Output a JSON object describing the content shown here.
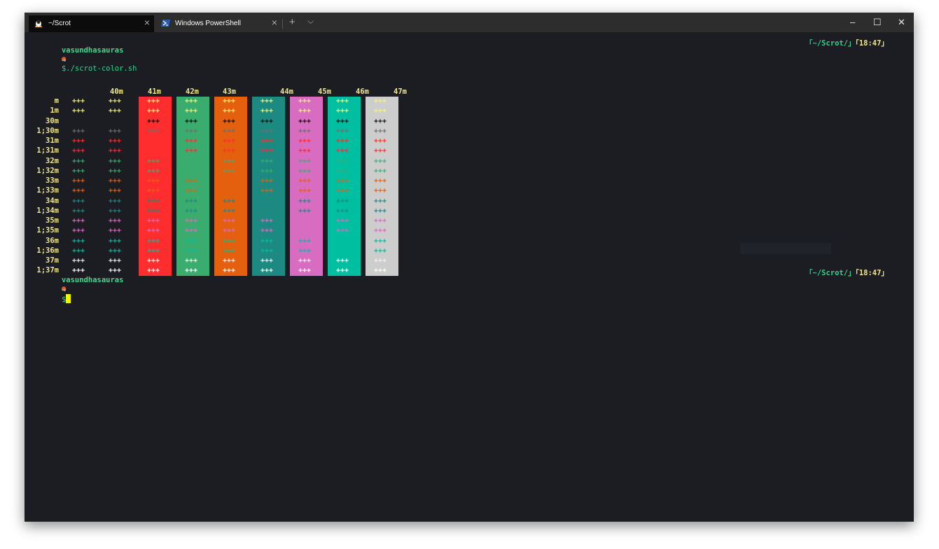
{
  "tabs": [
    {
      "label": "~/Scrot",
      "icon": "linux-icon",
      "active": true
    },
    {
      "label": "Windows PowerShell",
      "icon": "powershell-icon",
      "active": false
    }
  ],
  "tabbar": {
    "new_tab": "+",
    "dropdown": "⌵"
  },
  "window_controls": {
    "minimize": "‒",
    "maximize": "☐",
    "close": "✕"
  },
  "terminal": {
    "prompt1": {
      "user": "vasundhasauras",
      "dot": "●",
      "arrow": "→",
      "command": "$./scrot-color.sh",
      "path": "「~/Scrot/」",
      "time": "「18:47」"
    },
    "prompt2": {
      "user": "vasundhasauras",
      "dot": "●",
      "arrow": "→",
      "command": "$",
      "path": "「~/Scrot/」",
      "time": "「18:47」"
    },
    "color_table": {
      "column_headers": [
        "40m",
        "41m",
        "42m",
        "43m",
        "44m",
        "45m",
        "46m",
        "47m"
      ],
      "row_labels": [
        "m",
        "1m",
        "30m",
        "1;30m",
        "31m",
        "1;31m",
        "32m",
        "1;32m",
        "33m",
        "1;33m",
        "34m",
        "1;34m",
        "35m",
        "1;35m",
        "36m",
        "1;36m",
        "37m",
        "1;37m"
      ],
      "cell_text": "+++",
      "bg_colors": [
        "#ff2d2d",
        "#3aad6e",
        "#e5600e",
        "#1c8a80",
        "#d76cc0",
        "#00bea0",
        "#cdcdcd"
      ],
      "fg_colors": [
        "#f4f47a",
        "#f4f47a",
        "#0c0c0c",
        "#6e6e6e",
        "#ff2d2d",
        "#ff2d2d",
        "#3aad6e",
        "#3aad6e",
        "#e5600e",
        "#e5600e",
        "#1c8a80",
        "#1c8a80",
        "#d76cc0",
        "#d76cc0",
        "#00bea0",
        "#00bea0",
        "#f0f0f0",
        "#ffffff"
      ]
    }
  }
}
